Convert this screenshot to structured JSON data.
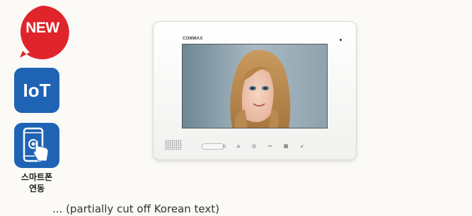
{
  "badges": {
    "new_label": "NEW",
    "iot_label": "IoT",
    "smartphone_caption_line1": "스마트폰",
    "smartphone_caption_line2": "연동"
  },
  "product": {
    "brand": "COMMAX"
  },
  "footer": {
    "text": "... (partially cut off Korean text)"
  },
  "colors": {
    "new_badge": "#e0242b",
    "feature_badge": "#1f63b5",
    "background": "#fbfaf6"
  },
  "icons": [
    "new-badge-icon",
    "iot-icon",
    "smartphone-touch-icon",
    "monitor-buttons"
  ]
}
